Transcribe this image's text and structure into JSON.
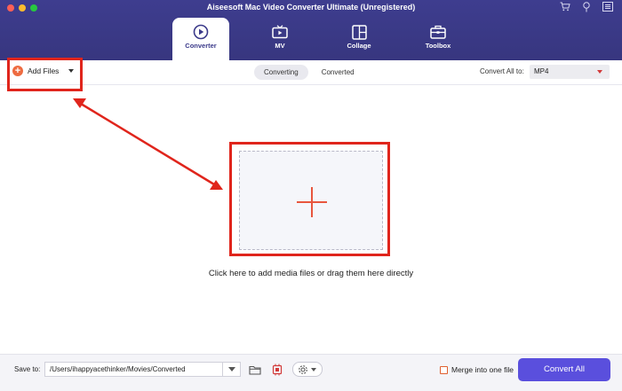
{
  "window": {
    "title": "Aiseesoft Mac Video Converter Ultimate (Unregistered)",
    "tool_icons": [
      "cart-icon",
      "help-icon",
      "menu-icon"
    ]
  },
  "tabs": [
    {
      "label": "Converter",
      "icon": "converter-icon",
      "active": true
    },
    {
      "label": "MV",
      "icon": "tv-icon",
      "active": false
    },
    {
      "label": "Collage",
      "icon": "collage-icon",
      "active": false
    },
    {
      "label": "Toolbox",
      "icon": "toolbox-icon",
      "active": false
    }
  ],
  "toolbar": {
    "add_files_label": "Add Files",
    "segments": [
      {
        "label": "Converting",
        "active": true
      },
      {
        "label": "Converted",
        "active": false
      }
    ],
    "convert_all_to_label": "Convert All to:",
    "format_value": "MP4"
  },
  "main": {
    "drop_hint": "Click here to add media files or drag them here directly"
  },
  "bottom": {
    "save_to_label": "Save to:",
    "save_path": "/Users/ihappyacethinker/Movies/Converted",
    "merge_label": "Merge into one file",
    "merge_checked": false,
    "convert_all_label": "Convert All"
  },
  "colors": {
    "nav_bg": "#3b3a8a",
    "accent_orange": "#ee6b40",
    "annotation_red": "#e0251c",
    "convert_button": "#5a4fdd"
  }
}
